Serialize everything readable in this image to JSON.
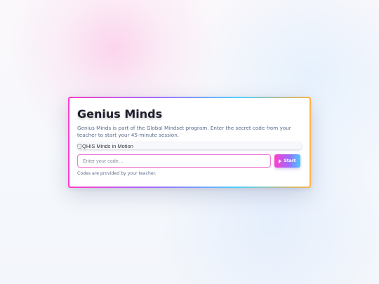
{
  "app": {
    "title": "Genius Minds",
    "description": "Genius Minds is part of the Global Mindset program. Enter the secret code from your teacher to start your 45-minute session."
  },
  "banner": {
    "alt_text": "QHIS Minds in Motion",
    "icon": "broken-image-icon"
  },
  "form": {
    "code_placeholder": "Enter your code…",
    "code_value": "",
    "start_label": "Start",
    "start_icon": "play-icon",
    "note": "Codes are provided by your teacher."
  },
  "colors": {
    "accent_pink": "#ff3ec8",
    "accent_purple": "#9d6bff",
    "accent_blue": "#47c9ff",
    "accent_orange": "#ffb347",
    "text_muted": "#5a6b8c"
  }
}
